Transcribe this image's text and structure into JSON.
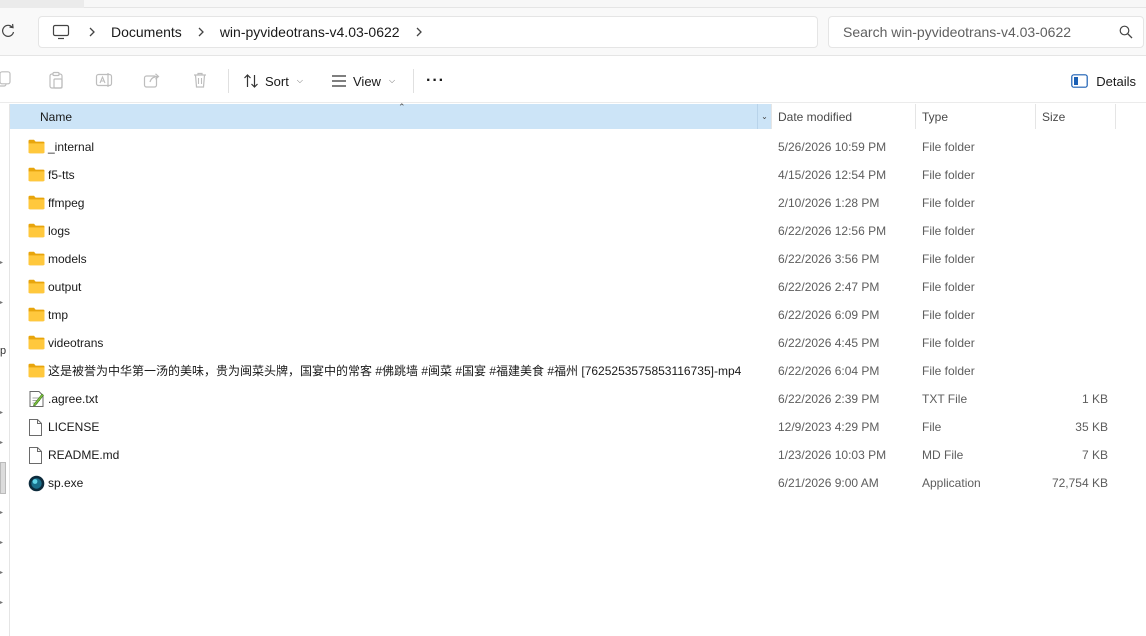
{
  "breadcrumb": {
    "items": [
      "Documents",
      "win-pyvideotrans-v4.03-0622"
    ]
  },
  "search": {
    "placeholder": "Search win-pyvideotrans-v4.03-0622"
  },
  "toolbar": {
    "sort_label": "Sort",
    "view_label": "View",
    "more_label": "···",
    "details_label": "Details"
  },
  "columns": {
    "name": "Name",
    "date": "Date modified",
    "type": "Type",
    "size": "Size"
  },
  "left_rail": {
    "cut_text": "p"
  },
  "files": [
    {
      "name": "_internal",
      "date": "5/26/2026 10:59 PM",
      "type": "File folder",
      "size": "",
      "icon": "folder"
    },
    {
      "name": "f5-tts",
      "date": "4/15/2026 12:54 PM",
      "type": "File folder",
      "size": "",
      "icon": "folder"
    },
    {
      "name": "ffmpeg",
      "date": "2/10/2026 1:28 PM",
      "type": "File folder",
      "size": "",
      "icon": "folder"
    },
    {
      "name": "logs",
      "date": "6/22/2026 12:56 PM",
      "type": "File folder",
      "size": "",
      "icon": "folder"
    },
    {
      "name": "models",
      "date": "6/22/2026 3:56 PM",
      "type": "File folder",
      "size": "",
      "icon": "folder"
    },
    {
      "name": "output",
      "date": "6/22/2026 2:47 PM",
      "type": "File folder",
      "size": "",
      "icon": "folder"
    },
    {
      "name": "tmp",
      "date": "6/22/2026 6:09 PM",
      "type": "File folder",
      "size": "",
      "icon": "folder"
    },
    {
      "name": "videotrans",
      "date": "6/22/2026 4:45 PM",
      "type": "File folder",
      "size": "",
      "icon": "folder"
    },
    {
      "name": "这是被誉为中华第一汤的美味，贵为闽菜头牌，国宴中的常客 #佛跳墙 #闽菜 #国宴 #福建美食 #福州 [7625253575853116735]-mp4",
      "date": "6/22/2026 6:04 PM",
      "type": "File folder",
      "size": "",
      "icon": "folder"
    },
    {
      "name": ".agree.txt",
      "date": "6/22/2026 2:39 PM",
      "type": "TXT File",
      "size": "1 KB",
      "icon": "text"
    },
    {
      "name": "LICENSE",
      "date": "12/9/2023 4:29 PM",
      "type": "File",
      "size": "35 KB",
      "icon": "file"
    },
    {
      "name": "README.md",
      "date": "1/23/2026 10:03 PM",
      "type": "MD File",
      "size": "7 KB",
      "icon": "file"
    },
    {
      "name": "sp.exe",
      "date": "6/21/2026 9:00 AM",
      "type": "Application",
      "size": "72,754 KB",
      "icon": "app"
    }
  ]
}
